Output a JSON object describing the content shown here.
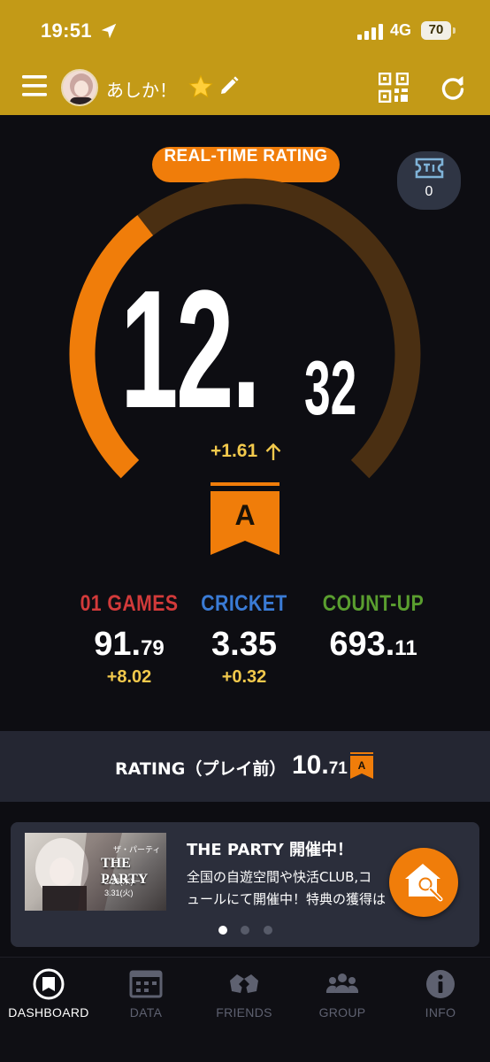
{
  "status_bar": {
    "time": "19:51",
    "network": "4G",
    "battery": "70"
  },
  "app_bar": {
    "user_name": "あしか！"
  },
  "rating": {
    "badge": "REAL-TIME RATING",
    "integer": "12.",
    "decimal": "32",
    "change": "+1.61",
    "class": "A",
    "gauge_fill_fraction": 0.36
  },
  "ticket": {
    "count": "0"
  },
  "stats": [
    {
      "label": "01 GAMES",
      "value_main": "91.",
      "value_small": "79",
      "delta": "+8.02",
      "color": "#d23a3a"
    },
    {
      "label": "CRICKET",
      "value_main": "3.35",
      "value_small": "",
      "delta": "+0.32",
      "color": "#3a7bd5"
    },
    {
      "label": "COUNT-UP",
      "value_main": "693.",
      "value_small": "11",
      "delta": "",
      "color": "#5a9e2f"
    }
  ],
  "prior": {
    "label": "RATING（プレイ前）",
    "value_main": "10.",
    "value_small": "71",
    "class": "A"
  },
  "banner": {
    "title": "THE PARTY 開催中！",
    "line1": "全国の自遊空間や快活CLUB,コ",
    "line2": "ュールにて開催中！特典の獲得は",
    "image_title": "THE PARTY",
    "image_sub": "ザ・パーティー",
    "image_date": "2.26(木)－3.31(火)"
  },
  "nav": [
    {
      "label": "DASHBOARD",
      "icon": "dashboard-icon"
    },
    {
      "label": "DATA",
      "icon": "data-icon"
    },
    {
      "label": "FRIENDS",
      "icon": "friends-icon"
    },
    {
      "label": "GROUP",
      "icon": "group-icon"
    },
    {
      "label": "INFO",
      "icon": "info-icon"
    }
  ],
  "colors": {
    "header": "#c39a17",
    "accent": "#f07d0a",
    "delta": "#f2c94c",
    "background": "#0d0d12"
  }
}
